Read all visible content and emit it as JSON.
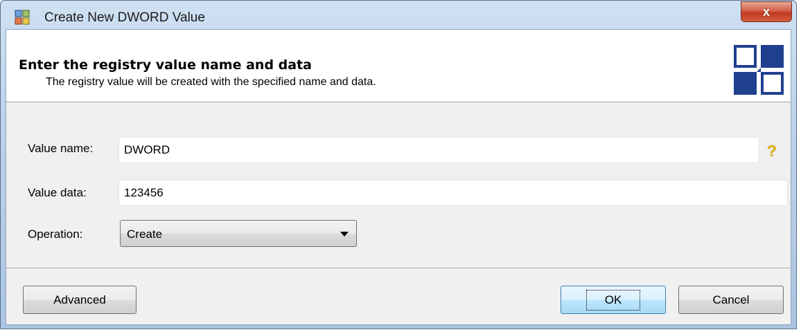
{
  "window": {
    "title": "Create New DWORD Value",
    "close_label": "x"
  },
  "header": {
    "title": "Enter the registry value name and data",
    "subtitle": "The registry value will be created with the specified name and data.",
    "logo_icon": "registry-blocks-icon"
  },
  "form": {
    "value_name": {
      "label": "Value name:",
      "value": "DWORD",
      "help_icon": "question-mark-icon",
      "help_glyph": "?"
    },
    "value_data": {
      "label": "Value data:",
      "value": "123456"
    },
    "operation": {
      "label": "Operation:",
      "selected": "Create"
    }
  },
  "buttons": {
    "advanced": "Advanced",
    "ok": "OK",
    "cancel": "Cancel"
  },
  "colors": {
    "logo_blue": "#1f3f8f",
    "help_yellow": "#e3b51a",
    "close_red": "#c1391f"
  }
}
